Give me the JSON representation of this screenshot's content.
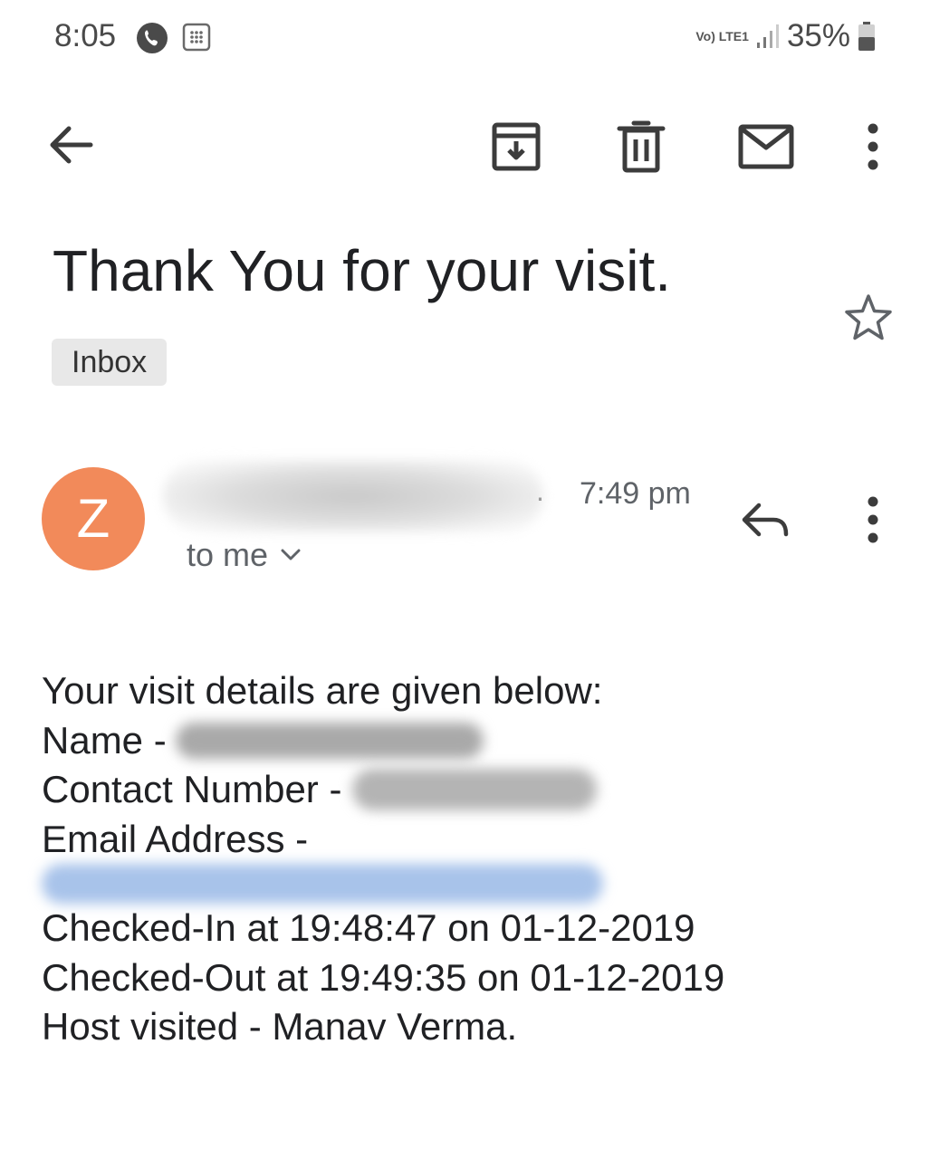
{
  "status_bar": {
    "time": "8:05",
    "network_label": "Vo) LTE1",
    "battery": "35%"
  },
  "toolbar": {
    "back_icon": "arrow-back-icon",
    "archive_icon": "archive-icon",
    "delete_icon": "trash-icon",
    "mark_unread_icon": "mail-icon",
    "more_icon": "more-vert-icon"
  },
  "email": {
    "subject": "Thank You for your visit.",
    "label": "Inbox",
    "star_icon": "star-outline-icon",
    "sender_initial": "Z",
    "avatar_color": "#f28a5a",
    "sender_redacted": true,
    "time": "7:49 pm",
    "recipient": "to me",
    "body": {
      "intro": "Your visit details are given below:",
      "name_label": "Name -",
      "contact_label": "Contact Number -",
      "email_label": "Email Address -",
      "checked_in": "Checked-In at 19:48:47 on 01-12-2019",
      "checked_out": "Checked-Out at 19:49:35 on 01-12-2019",
      "host": "Host visited - Manav Verma."
    }
  }
}
